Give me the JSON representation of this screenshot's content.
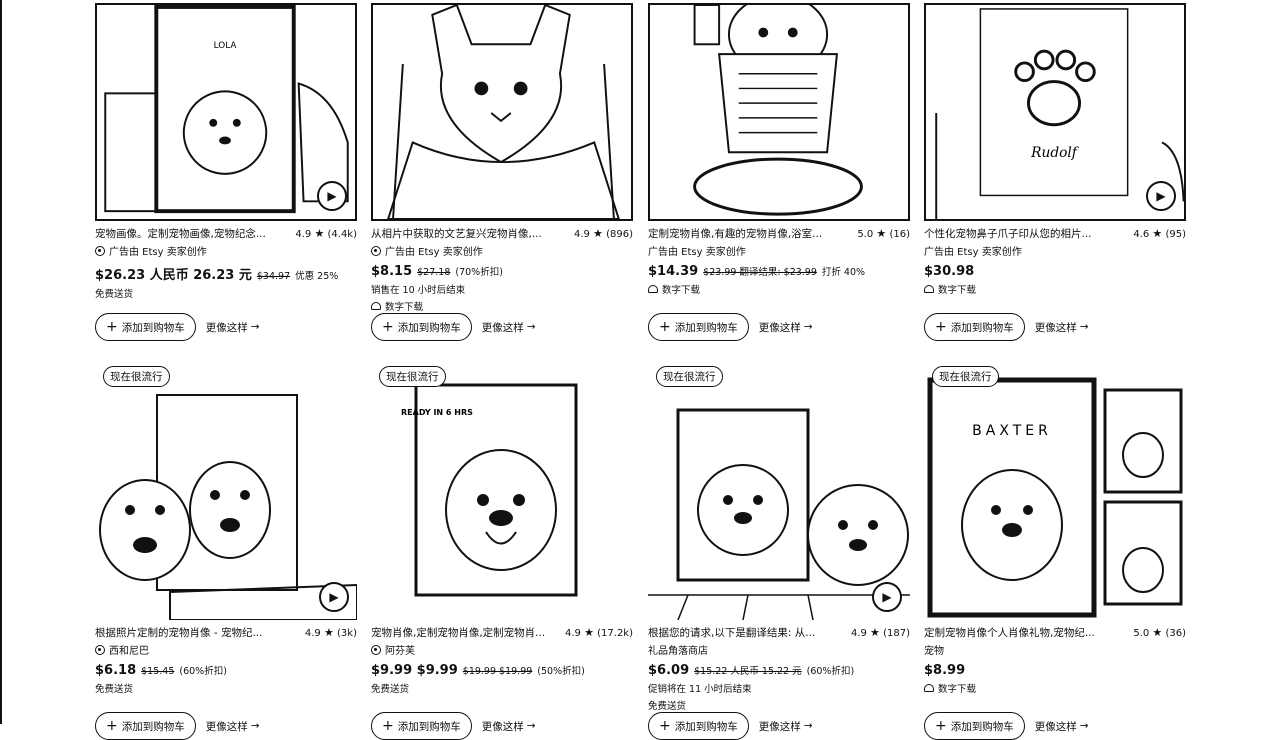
{
  "common": {
    "play_glyph": "▶",
    "star_glyph": "★",
    "add_to_cart": "添加到购物车",
    "more_like_this": "更像这样",
    "arrow_glyph": "→",
    "plus_glyph": "+",
    "trending": "现在很流行",
    "colors": {
      "ink": "#111111",
      "bg": "#ffffff"
    }
  },
  "listings": [
    {
      "title": "宠物画像。定制宠物画像,宠物纪念...",
      "rating": "4.9",
      "reviews": "(4.4k)",
      "seller": "广告由 Etsy 卖家创作",
      "price": "$26.23 人民币 26.23 元",
      "original": "$34.97",
      "discount": "优惠 25%",
      "line1": "免费送货",
      "line2": "",
      "image_label": "LOLA"
    },
    {
      "title": "从相片中获取的文艺复兴宠物肖像,...",
      "rating": "4.9",
      "reviews": "(896)",
      "seller": "广告由 Etsy 卖家创作",
      "price": "$8.15",
      "original": "$27.18",
      "discount": "(70%折扣)",
      "line1": "销售在 10 小时后结束",
      "line2": "数字下载",
      "image_label": ""
    },
    {
      "title": "定制宠物肖像,有趣的宠物肖像,浴室...",
      "rating": "5.0",
      "reviews": "(16)",
      "seller": "广告由 Etsy 卖家创作",
      "price": "$14.39",
      "original": "$23.99 翻译结果: $23.99",
      "discount": "打折 40%",
      "line1": "数字下载",
      "line2": "",
      "image_label": ""
    },
    {
      "title": "个性化宠物鼻子爪子印从您的相片...",
      "rating": "4.6",
      "reviews": "(95)",
      "seller": "广告由 Etsy 卖家创作",
      "price": "$30.98",
      "original": "",
      "discount": "",
      "line1": "数字下载",
      "line2": "",
      "image_label": "Rudolf"
    },
    {
      "title": "根据照片定制的宠物肖像 - 宠物纪...",
      "rating": "4.9",
      "reviews": "(3k)",
      "seller": "西和尼巴",
      "price": "$6.18",
      "original": "$15.45",
      "discount": "(60%折扣)",
      "line1": "免费送货",
      "line2": "",
      "image_label": ""
    },
    {
      "title": "宠物肖像,定制宠物肖像,定制宠物肖...",
      "rating": "4.9",
      "reviews": "(17.2k)",
      "seller": "阿芬芙",
      "price": "$9.99 $9.99",
      "original": "$19.99 $19.99",
      "discount": "(50%折扣)",
      "line1": "免费送货",
      "line2": "",
      "image_label": "READY IN 6 HRS"
    },
    {
      "title": "根据您的请求,以下是翻译结果: 从...",
      "rating": "4.9",
      "reviews": "(187)",
      "seller": "礼品角落商店",
      "price": "$6.09",
      "original": "$15.22 人民币 15.22 元",
      "discount": "(60%折扣)",
      "line1": "促销将在 11 小时后结束",
      "line2": "免费送货",
      "image_label": ""
    },
    {
      "title": "定制宠物肖像个人肖像礼物,宠物纪...",
      "rating": "5.0",
      "reviews": "(36)",
      "seller": "宠物",
      "price": "$8.99",
      "original": "",
      "discount": "",
      "line1": "数字下载",
      "line2": "",
      "image_label": "BAXTER"
    }
  ]
}
